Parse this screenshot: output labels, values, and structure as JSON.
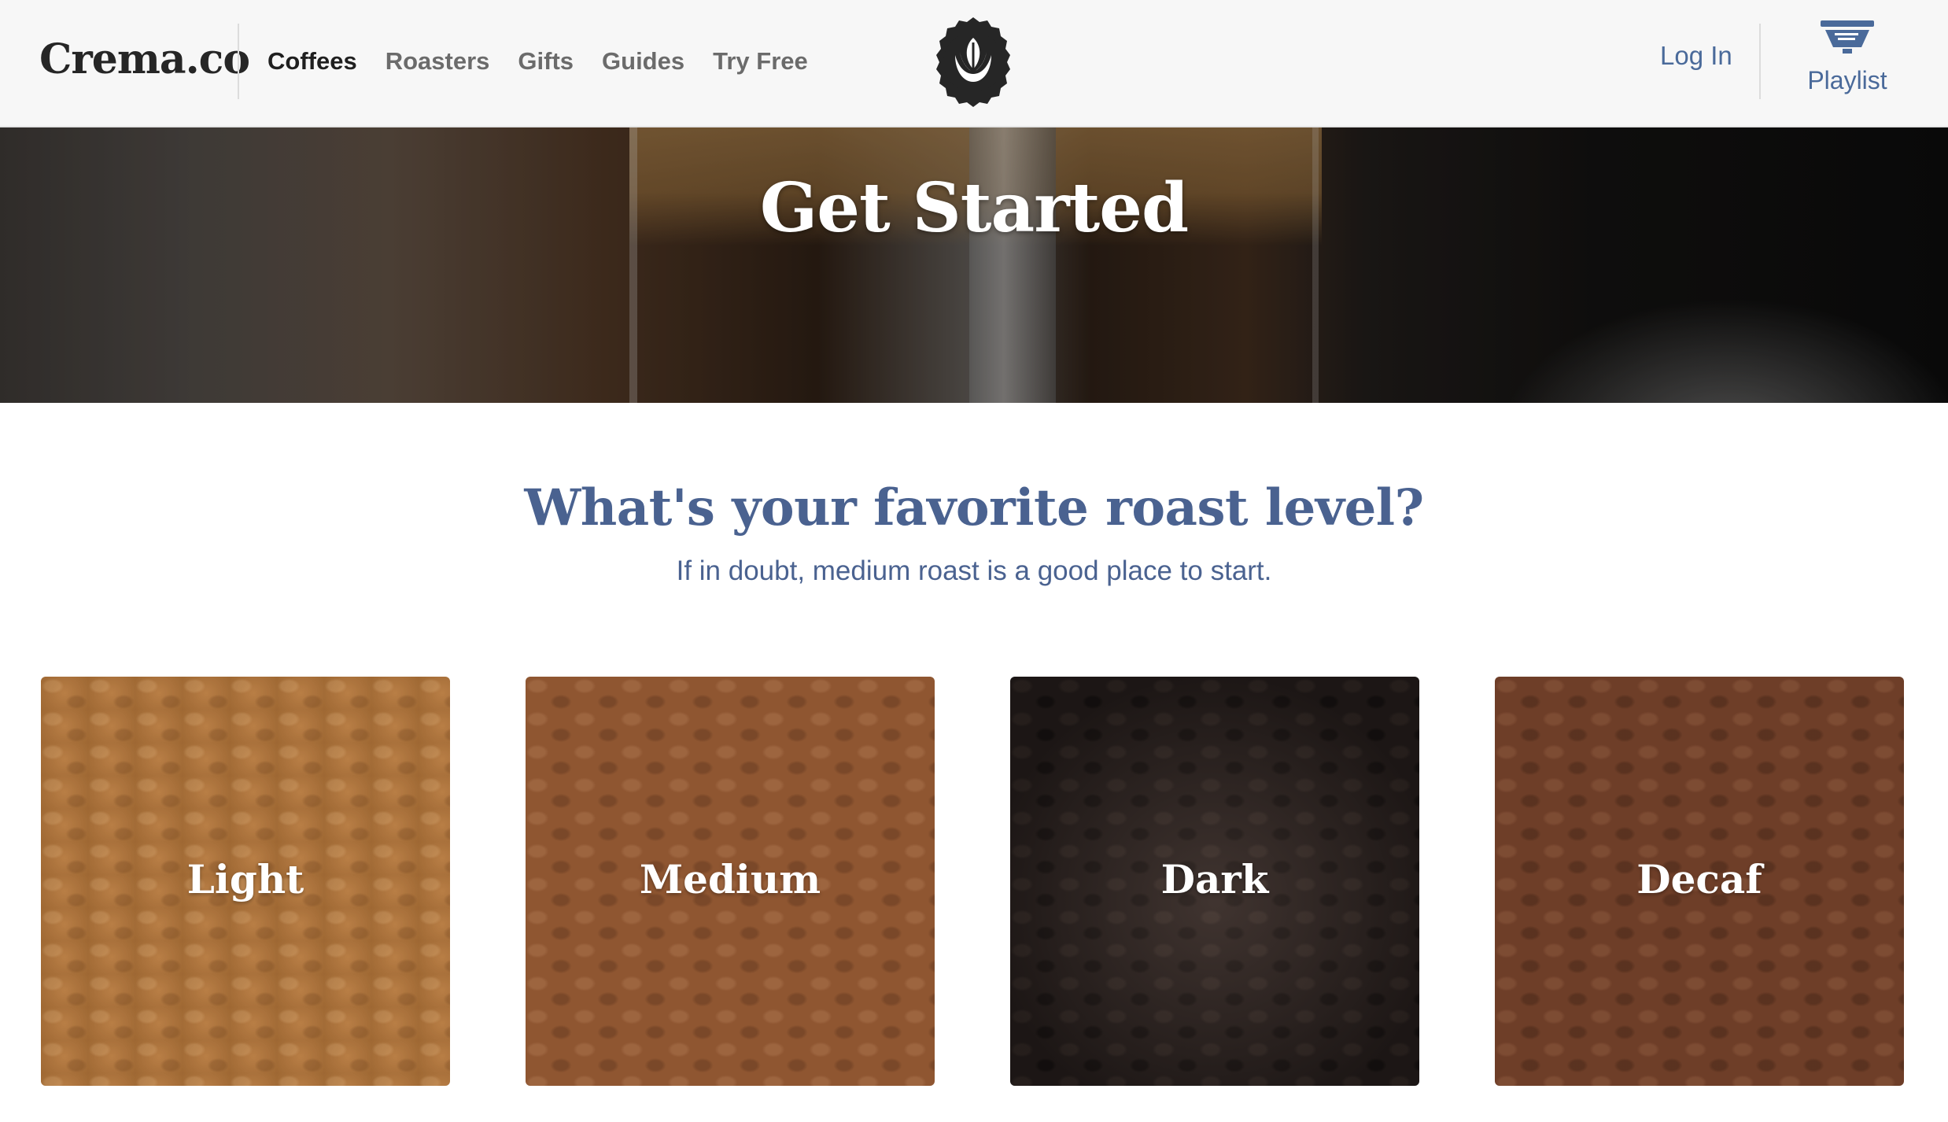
{
  "header": {
    "brand": "Crema.co",
    "nav": [
      {
        "label": "Coffees",
        "active": true
      },
      {
        "label": "Roasters",
        "active": false
      },
      {
        "label": "Gifts",
        "active": false
      },
      {
        "label": "Guides",
        "active": false
      },
      {
        "label": "Try Free",
        "active": false
      }
    ],
    "logo_icon": "latte-art-leaf-icon",
    "login_label": "Log In",
    "playlist_icon": "coffee-dripper-icon",
    "playlist_label": "Playlist"
  },
  "hero": {
    "title": "Get Started"
  },
  "question": {
    "title": "What's your favorite roast level?",
    "subtitle": "If in doubt, medium roast is a good place to start."
  },
  "roasts": [
    {
      "label": "Light",
      "color": "#b4763a"
    },
    {
      "label": "Medium",
      "color": "#8f5631"
    },
    {
      "label": "Dark",
      "color": "#2b2220"
    },
    {
      "label": "Decaf",
      "color": "#6e3e28"
    }
  ],
  "colors": {
    "accent_blue": "#4a6290",
    "link_blue": "#4a6a9a",
    "header_bg": "#f7f7f7"
  }
}
